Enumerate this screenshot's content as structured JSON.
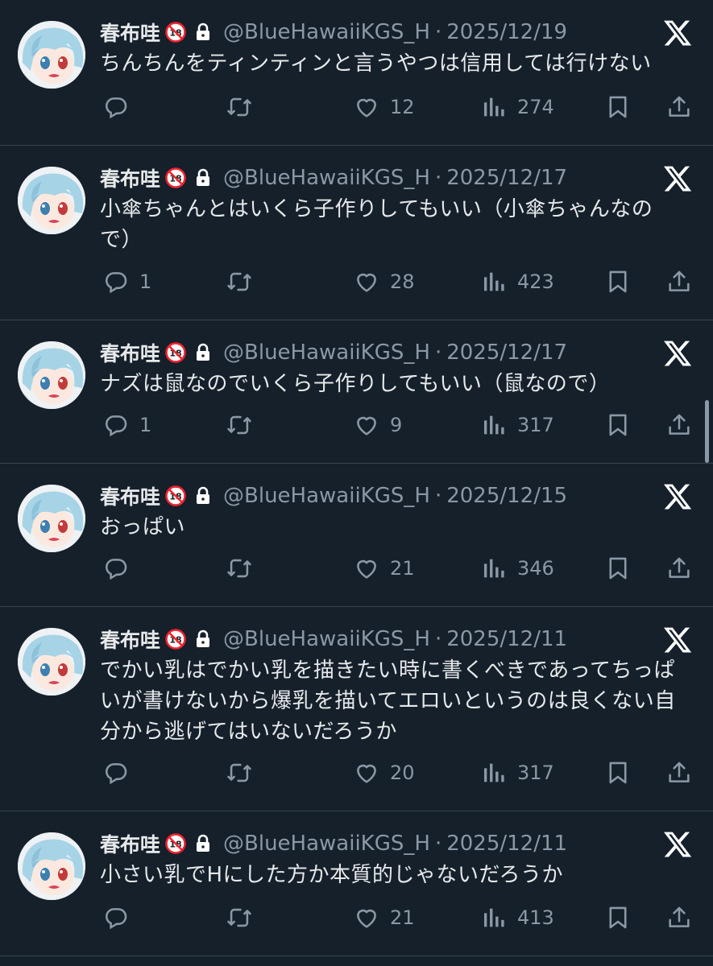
{
  "profile": {
    "name": "春布哇",
    "handle": "@BlueHawaiiKGS_H",
    "separator": "·"
  },
  "tweets": [
    {
      "date": "2025/12/19",
      "text": "ちんちんをティンティンと言うやつは信用しては行けない",
      "replies": "",
      "retweets": "",
      "likes": "12",
      "views": "274"
    },
    {
      "date": "2025/12/17",
      "text": "小傘ちゃんとはいくら子作りしてもいい（小傘ちゃんなので）",
      "replies": "1",
      "retweets": "",
      "likes": "28",
      "views": "423"
    },
    {
      "date": "2025/12/17",
      "text": "ナズは鼠なのでいくら子作りしてもいい（鼠なので）",
      "replies": "1",
      "retweets": "",
      "likes": "9",
      "views": "317"
    },
    {
      "date": "2025/12/15",
      "text": "おっぱい",
      "replies": "",
      "retweets": "",
      "likes": "21",
      "views": "346"
    },
    {
      "date": "2025/12/11",
      "text": "でかい乳はでかい乳を描きたい時に書くべきであってちっぱいが書けないから爆乳を描いてエロいというのは良くない自分から逃げてはいないだろうか",
      "replies": "",
      "retweets": "",
      "likes": "20",
      "views": "317"
    },
    {
      "date": "2025/12/11",
      "text": "小さい乳でHにした方か本質的じゃないだろうか",
      "replies": "",
      "retweets": "",
      "likes": "21",
      "views": "413"
    }
  ],
  "icons": {
    "reply": "reply-icon",
    "retweet": "retweet-icon",
    "like": "heart-icon",
    "views": "views-icon",
    "bookmark": "bookmark-icon",
    "share": "share-icon",
    "logo": "x-logo-icon",
    "lock": "lock-icon",
    "r18": "r18-badge-icon"
  },
  "colors": {
    "background": "#15202b",
    "text": "#e7e9ea",
    "muted": "#8b98a5",
    "divider": "#38444d",
    "r18": "#f4212e"
  }
}
